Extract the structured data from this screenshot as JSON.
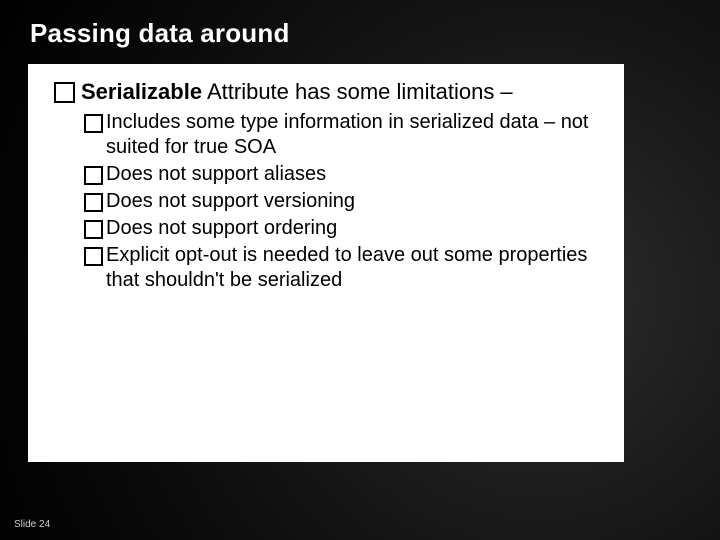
{
  "slide": {
    "title": "Passing data around",
    "main_bullet_bold": "Serializable",
    "main_bullet_rest": " Attribute has some limitations –",
    "sub_bullets": [
      "Includes some type information in serialized data – not suited for true SOA",
      "Does not support aliases",
      "Does not support versioning",
      "Does not support ordering",
      "Explicit opt-out is needed to leave out some properties that shouldn't be serialized"
    ],
    "footer": "Slide 24"
  }
}
